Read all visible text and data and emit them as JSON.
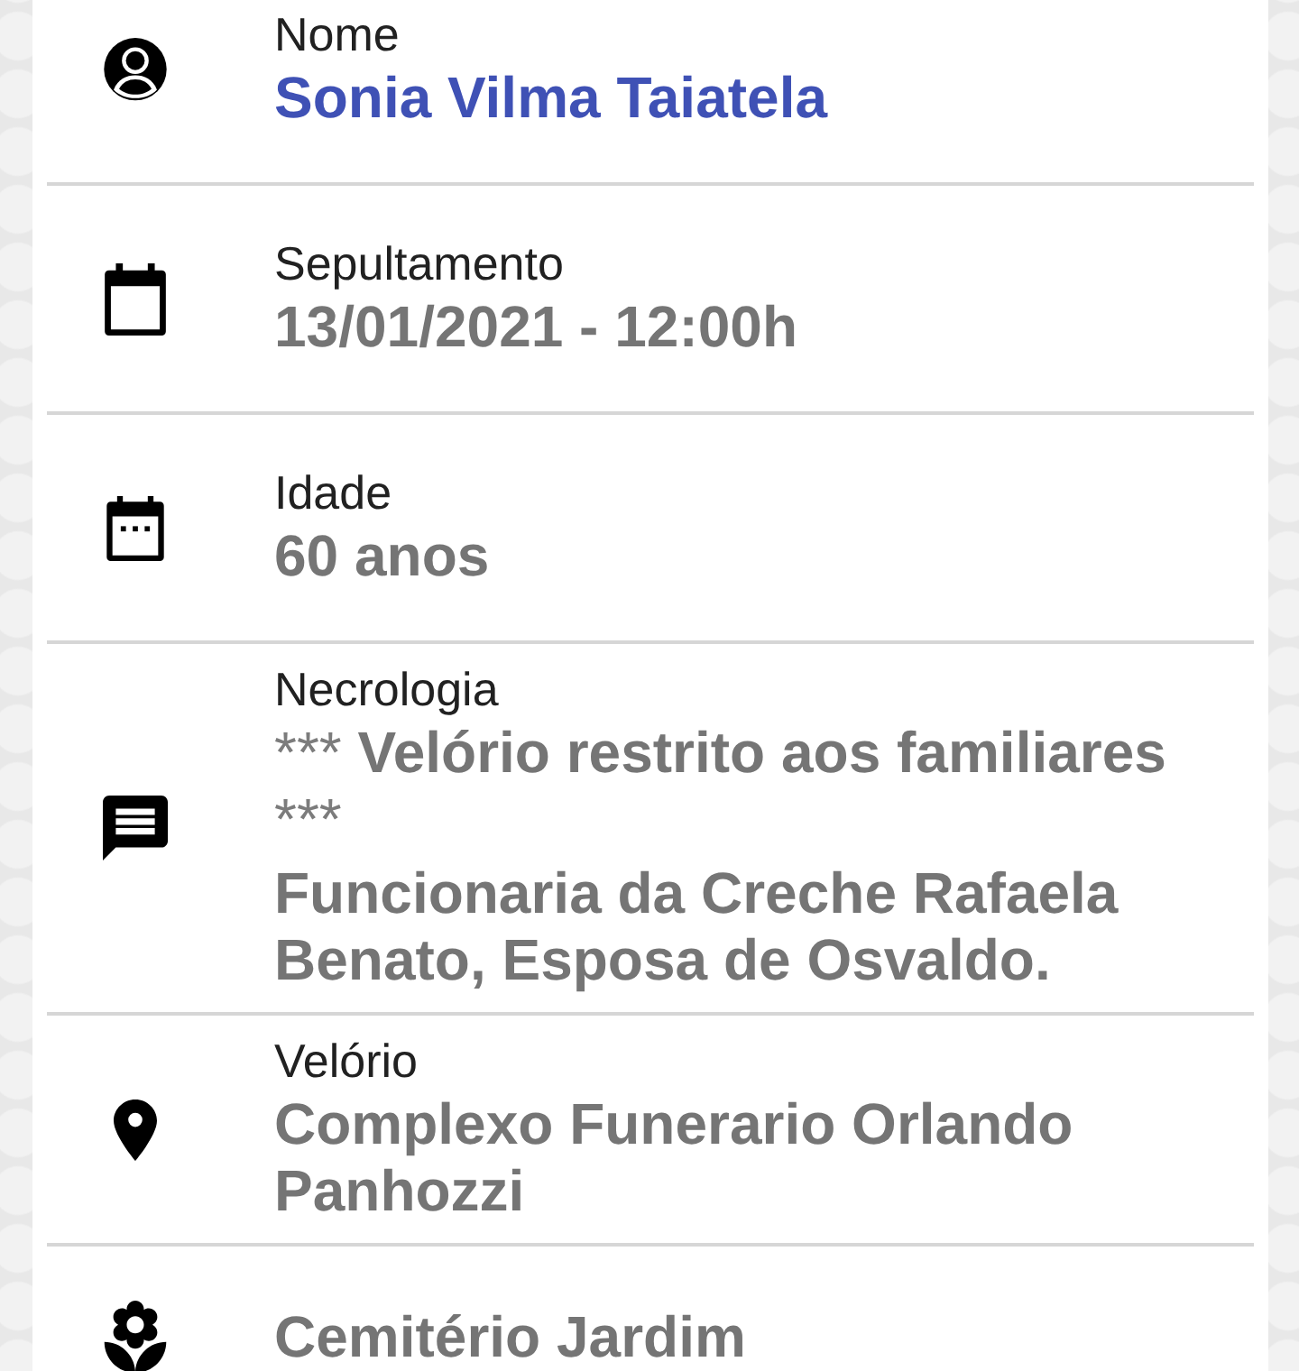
{
  "details": [
    {
      "kind": "name",
      "label": "Nome",
      "value": "Sonia Vilma Taiatela",
      "highlighted": true
    },
    {
      "kind": "burial",
      "label": "Sepultamento",
      "value": "13/01/2021 - 12:00h",
      "highlighted": false
    },
    {
      "kind": "age",
      "label": "Idade",
      "value": "60 anos",
      "highlighted": false
    },
    {
      "kind": "obituary",
      "label": "Necrologia",
      "notice": {
        "prefix": "***",
        "text": "Velório restrito aos familiares",
        "suffix": "***"
      },
      "body": "Funcionaria da Creche Rafaela Benato, Esposa de Osvaldo.",
      "highlighted": false
    },
    {
      "kind": "wake",
      "label": "Velório",
      "value": "Complexo Funerario Orlando Panhozzi",
      "highlighted": false
    },
    {
      "kind": "cemetery",
      "value": "Cemitério Jardim",
      "highlighted": false
    }
  ]
}
